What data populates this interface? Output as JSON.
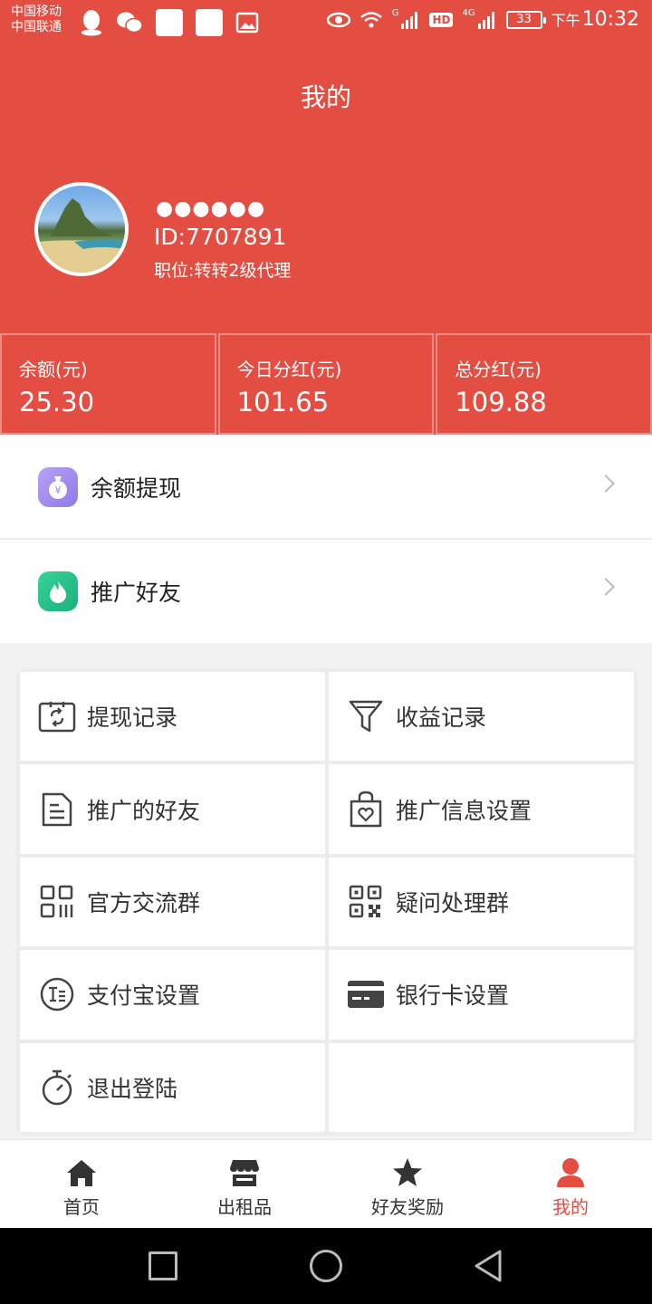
{
  "status_bar": {
    "carrier_1": "中国移动",
    "carrier_2": "中国联通",
    "network_hd": "HD",
    "network_4g": "4G",
    "signal_g": "G",
    "battery": "33",
    "time_prefix": "下午",
    "time": "10:32"
  },
  "header": {
    "title": "我的"
  },
  "profile": {
    "name": "●●●●●●",
    "id": "ID:7707891",
    "position": "职位:转转2级代理"
  },
  "stats": [
    {
      "label": "余额(元)",
      "value": "25.30"
    },
    {
      "label": "今日分红(元)",
      "value": "101.65"
    },
    {
      "label": "总分红(元)",
      "value": "109.88"
    }
  ],
  "menu": [
    {
      "label": "余额提现",
      "icon": "money-bag-icon"
    },
    {
      "label": "推广好友",
      "icon": "flame-icon"
    }
  ],
  "grid": [
    {
      "label": "提现记录",
      "icon": "withdraw-record-icon"
    },
    {
      "label": "收益记录",
      "icon": "filter-icon"
    },
    {
      "label": "推广的好友",
      "icon": "document-icon"
    },
    {
      "label": "推广信息设置",
      "icon": "gift-bag-icon"
    },
    {
      "label": "官方交流群",
      "icon": "grid-icon"
    },
    {
      "label": "疑问处理群",
      "icon": "qrcode-icon"
    },
    {
      "label": "支付宝设置",
      "icon": "alipay-icon"
    },
    {
      "label": "银行卡设置",
      "icon": "bank-card-icon"
    },
    {
      "label": "退出登陆",
      "icon": "stopwatch-icon"
    }
  ],
  "bottom_nav": [
    {
      "label": "首页",
      "icon": "home-icon"
    },
    {
      "label": "出租品",
      "icon": "store-icon"
    },
    {
      "label": "好友奖励",
      "icon": "star-icon"
    },
    {
      "label": "我的",
      "icon": "user-icon"
    }
  ],
  "colors": {
    "brand": "#e44d42",
    "active_nav": "#e44d42"
  }
}
